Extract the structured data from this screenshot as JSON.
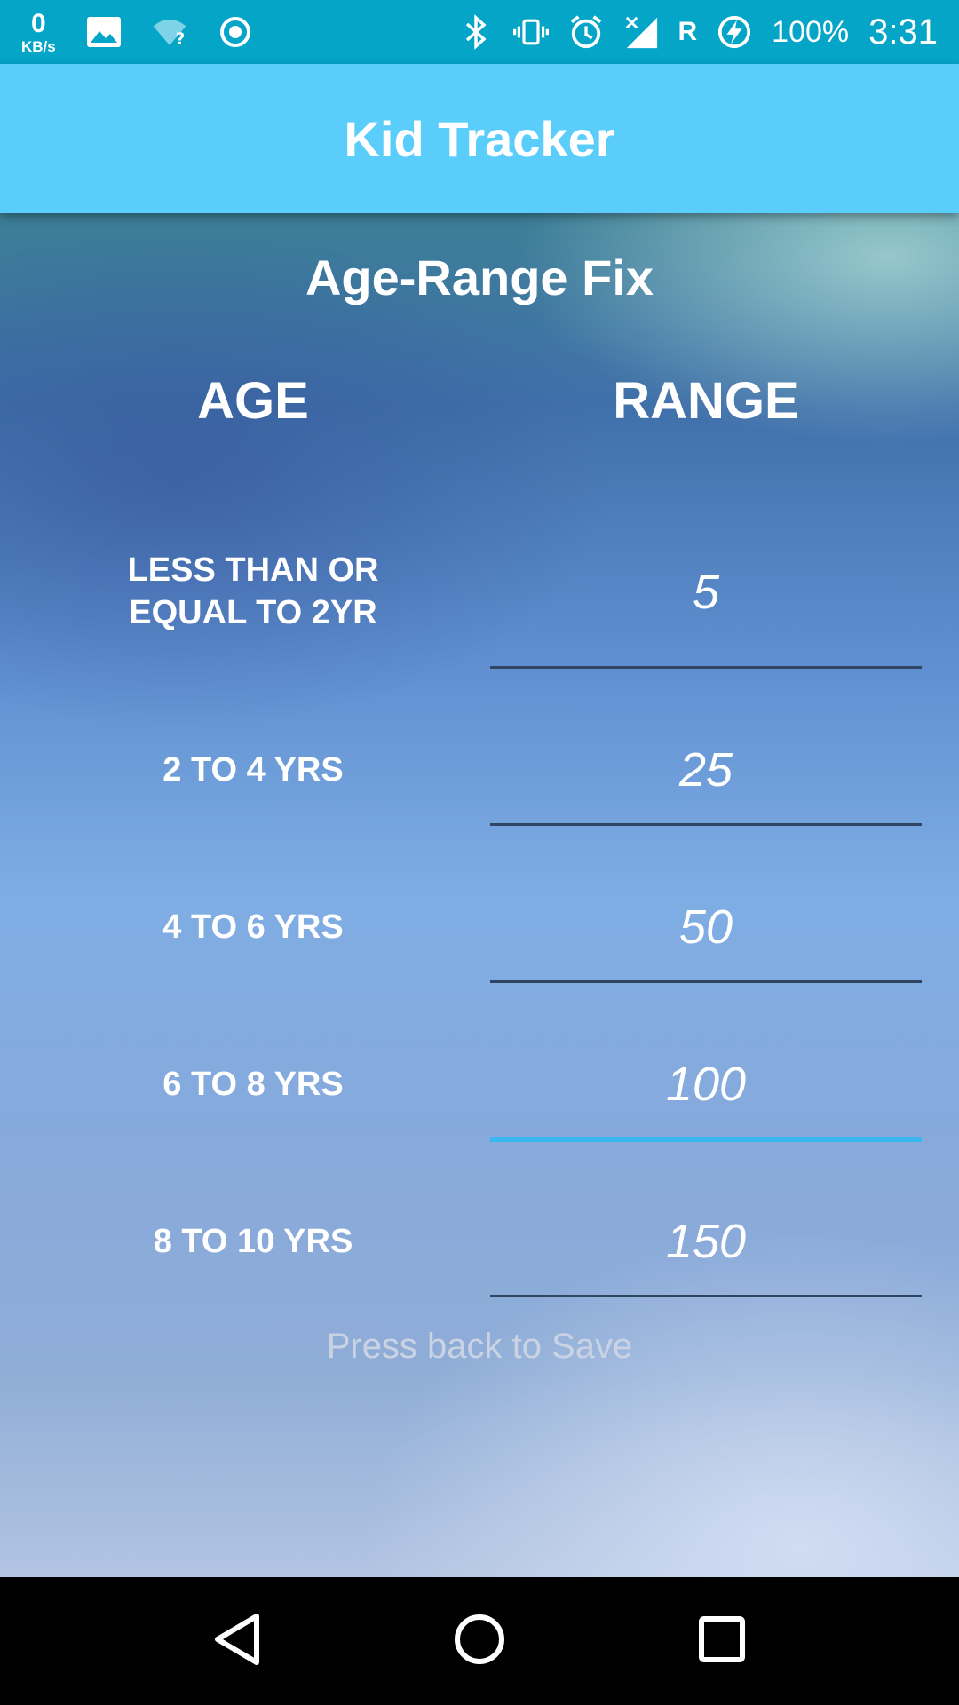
{
  "status_bar": {
    "net_speed_value": "0",
    "net_speed_unit": "KB/s",
    "roaming": "R",
    "battery": "100%",
    "time": "3:31",
    "icons": [
      "image-icon",
      "wifi-question-icon",
      "record-icon",
      "bluetooth-icon",
      "vibrate-icon",
      "alarm-icon",
      "signal-icon",
      "charging-icon"
    ]
  },
  "app_bar": {
    "title": "Kid Tracker"
  },
  "page": {
    "title": "Age-Range Fix",
    "headers": {
      "age": "AGE",
      "range": "RANGE"
    },
    "rows": [
      {
        "age_line1": "LESS THAN OR",
        "age_line2": "EQUAL TO 2YR",
        "range": "5"
      },
      {
        "age": "2 TO 4 YRS",
        "range": "25"
      },
      {
        "age": "4 TO 6 YRS",
        "range": "50"
      },
      {
        "age": "6 TO 8 YRS",
        "range": "100"
      },
      {
        "age": "8 TO 10 YRS",
        "range": "150"
      }
    ],
    "active_row": 3,
    "hint": "Press back to Save"
  },
  "colors": {
    "status_bar": "#05a5c8",
    "app_bar": "#5bcdfb",
    "active_underline": "#39b8f0",
    "underline": "#2f4562"
  },
  "nav_bar": {
    "icons": [
      "back-icon",
      "home-icon",
      "recents-icon"
    ]
  }
}
